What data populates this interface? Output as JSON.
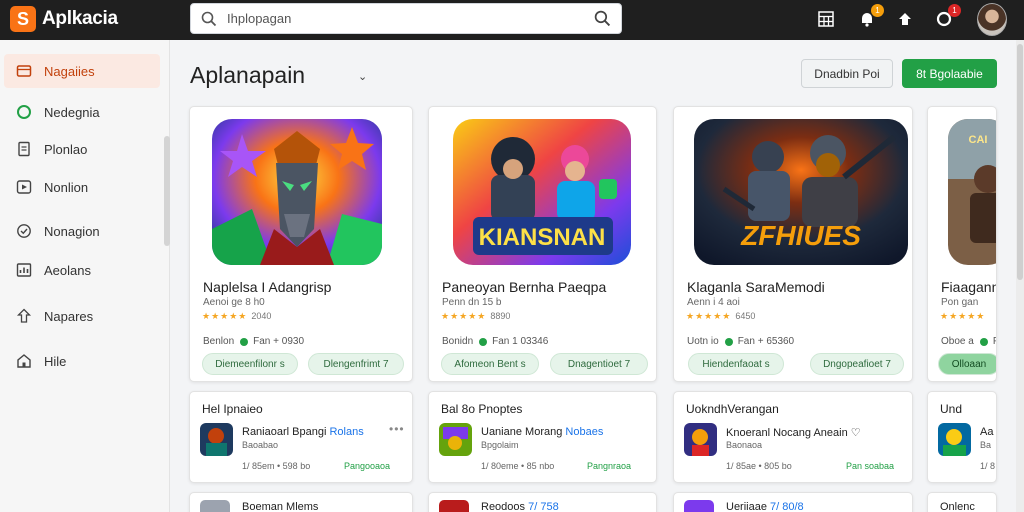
{
  "header": {
    "logo_glyph": "S",
    "app_title": "Aplkacia",
    "search_placeholder": "Ihplopagan",
    "notification_badge": "1",
    "alert_badge": "1"
  },
  "sidebar": {
    "items": [
      {
        "label": "Nagaiies",
        "icon": "folder-icon",
        "active": true
      },
      {
        "label": "Nedegnia",
        "icon": "circle-icon",
        "active": false
      },
      {
        "label": "Plonlao",
        "icon": "document-icon",
        "active": false
      },
      {
        "label": "Nonlion",
        "icon": "play-icon",
        "active": false
      },
      {
        "label": "Nonagion",
        "icon": "shield-icon",
        "active": false
      },
      {
        "label": "Aeolans",
        "icon": "chart-icon",
        "active": false
      },
      {
        "label": "Napares",
        "icon": "upload-icon",
        "active": false
      },
      {
        "label": "Hile",
        "icon": "home-icon",
        "active": false
      }
    ]
  },
  "main": {
    "title": "Aplanapain",
    "title_arrow": "⌄",
    "secondary_button": "Dnadbin Poi",
    "primary_button": "8t Bgolaabie",
    "app_cards": [
      {
        "name": "Naplelsa I Adangrisp",
        "dev": "Aenoi ge 8 h0",
        "stars": "★★★★★",
        "rating_count": "2040",
        "meta_left": "Benlon",
        "meta_right": "Fan + 0930",
        "chip1": "Diemeenfilonr s",
        "chip2": "Dlengenfrimt 7"
      },
      {
        "name": "Paneoyan Bernha Paeqpa",
        "dev": "Penn dn 15 b",
        "stars": "★★★★★",
        "rating_count": "8890",
        "meta_left": "Bonidn",
        "meta_right": "Fan 1 03346",
        "chip1": "Afomeon Bent s",
        "chip2": "Dnagentioet 7"
      },
      {
        "name": "Klaganla SaraMemodi",
        "dev": "Aenn i 4 aoi",
        "stars": "★★★★★",
        "rating_count": "6450",
        "meta_left": "Uotn io",
        "meta_right": "Fan + 65360",
        "chip1": "Hiendenfaoat s",
        "chip2": "Dngopeafioet 7"
      },
      {
        "name": "Fiaagann",
        "dev": "Pon gan",
        "stars": "★★★★★",
        "rating_count": "",
        "meta_left": "Oboe a",
        "meta_right": "Fa",
        "chip1": "Olloaan",
        "chip2": ""
      }
    ],
    "list_cards": [
      {
        "header": "Hel Ipnaieo",
        "title": "Raniaoarl Bpangi",
        "tag": "Rolans",
        "sub": "Baoabao",
        "meta": "1/ 85em • 598 bo",
        "action": "Pangooaoa"
      },
      {
        "header": "Bal 8o Pnoptes",
        "title": "Uaniane Morang",
        "tag": "Nobaes",
        "sub": "Bpgolaim",
        "meta": "1/ 80eme • 85 nbo",
        "action": "Pangnraoa"
      },
      {
        "header": "UokndhVerangan",
        "title": "Knoeranl Nocang Aneain",
        "tag": "♡",
        "sub": "Baonaoa",
        "meta": "1/ 85ae • 805 bo",
        "action": "Pan soabaa"
      },
      {
        "header": "Und",
        "title": "Aa",
        "tag": "",
        "sub": "Ba",
        "meta": "1/ 8",
        "action": ""
      }
    ],
    "bottom_cards": [
      {
        "title": "Boeman Mlems",
        "tag": ""
      },
      {
        "title": "Reodoos",
        "tag": "7/ 758"
      },
      {
        "title": "Ueriiaae",
        "tag": "7/ 80/8"
      },
      {
        "title": "Onlenc",
        "tag": ""
      }
    ]
  }
}
